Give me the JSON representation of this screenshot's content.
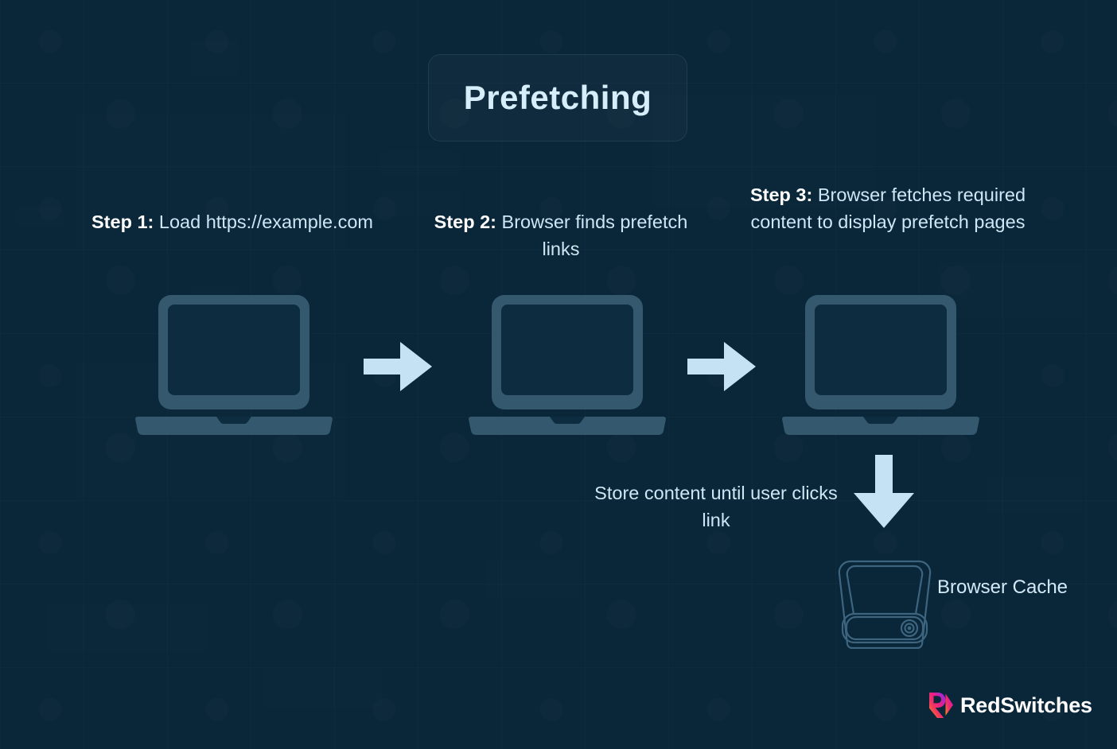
{
  "page": {
    "title": "Prefetching",
    "background_color": "#0a2639"
  },
  "colors": {
    "background": "#0a2639",
    "laptop_body": "#34586d",
    "laptop_screen": "#0d2c40",
    "arrow": "#c5e2f4",
    "text_primary": "#ffffff",
    "text_secondary": "#cfe6f4",
    "title_text": "#d6edfa",
    "cache_outline": "#3a6075",
    "logo_gradient_start": "#f7941e",
    "logo_gradient_mid": "#ed1e79",
    "logo_gradient_end": "#7b2ff7"
  },
  "steps": [
    {
      "id": "step-1",
      "label": "Step 1:",
      "description": " Load https://example.com",
      "device_icon": "laptop-icon"
    },
    {
      "id": "step-2",
      "label": "Step 2:",
      "description": " Browser finds prefetch links",
      "device_icon": "laptop-icon"
    },
    {
      "id": "step-3",
      "label": "Step 3:",
      "description": " Browser fetches required content to display prefetch pages",
      "device_icon": "laptop-icon"
    }
  ],
  "connectors": [
    {
      "id": "arrow-1",
      "icon": "arrow-right-icon"
    },
    {
      "id": "arrow-2",
      "icon": "arrow-right-icon"
    },
    {
      "id": "arrow-down",
      "icon": "arrow-down-icon"
    }
  ],
  "store_note": "Store content until user clicks link",
  "cache": {
    "icon": "hard-drive-icon",
    "label": "Browser Cache"
  },
  "logo": {
    "mark": "redswitches-logo-mark",
    "text": "RedSwitches"
  }
}
